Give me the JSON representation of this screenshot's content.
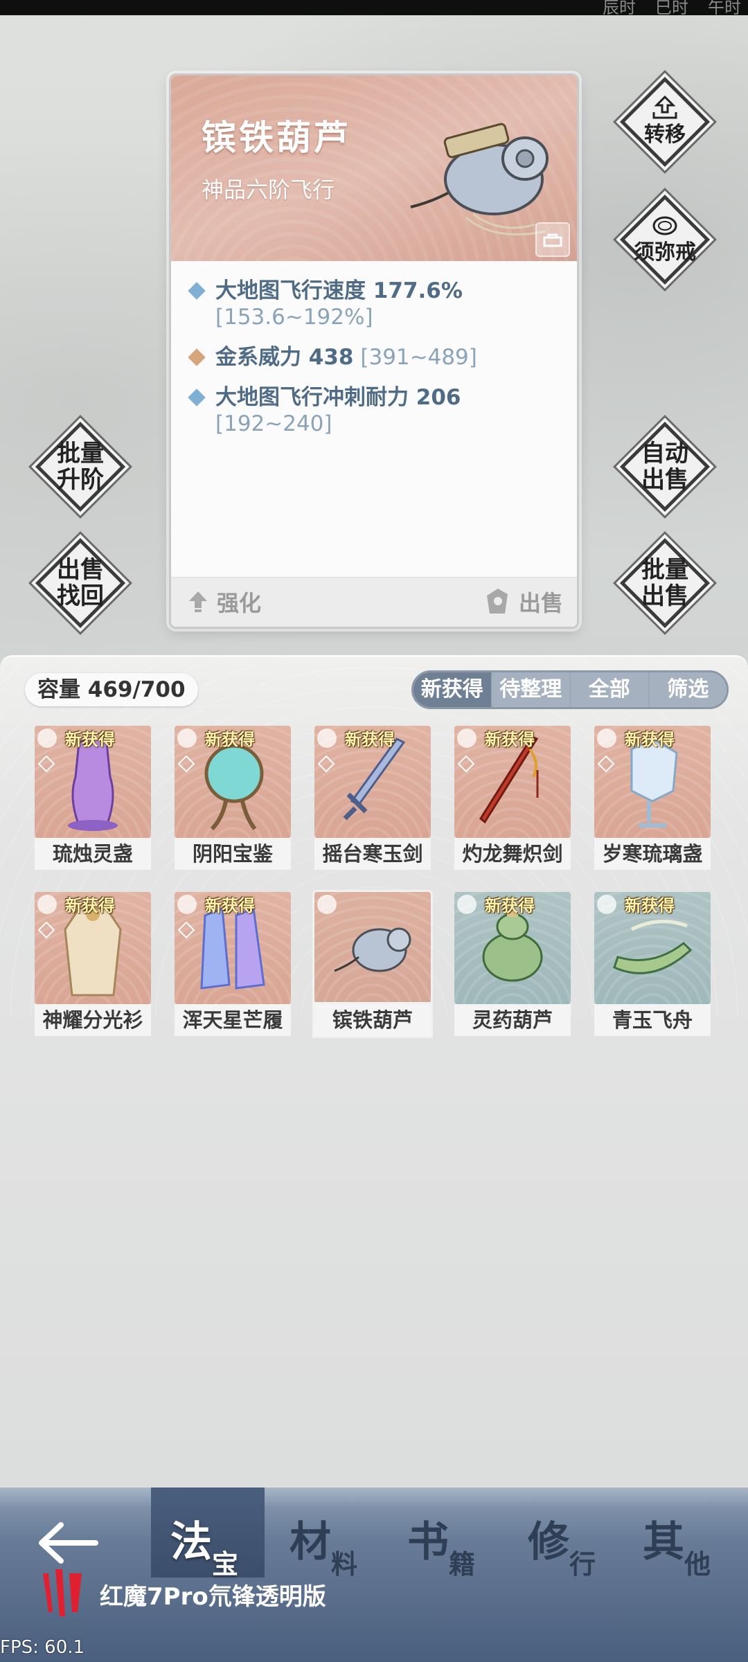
{
  "status_bar": {
    "clock_labels": [
      "辰时",
      "巳时",
      "午时"
    ]
  },
  "item_card": {
    "name": "镔铁葫芦",
    "subtitle": "神品六阶飞行",
    "stats": [
      {
        "name": "大地图飞行速度 177.6%",
        "range": "[153.6~192%]",
        "bullet_color": "#7fb0d3"
      },
      {
        "name": "金系威力 438",
        "range": "[391~489]",
        "bullet_color": "#d6a57c"
      },
      {
        "name": "大地图飞行冲刺耐力 206",
        "range": "[192~240]",
        "bullet_color": "#7fb0d3"
      }
    ],
    "enhance_label": "强化",
    "sell_label": "出售"
  },
  "side_buttons": {
    "transfer": "转移",
    "sumeru_ring": "须弥戒",
    "batch_upgrade": [
      "批量",
      "升阶"
    ],
    "auto_sell": [
      "自动",
      "出售"
    ],
    "sell_recover": [
      "出售",
      "找回"
    ],
    "batch_sell": [
      "批量",
      "出售"
    ]
  },
  "inventory": {
    "capacity_label": "容量 469/700",
    "filters": [
      "新获得",
      "待整理",
      "全部",
      "筛选"
    ],
    "new_tag": "新获得",
    "items": [
      {
        "name": "琉烛灵盏",
        "is_new": true
      },
      {
        "name": "阴阳宝鉴",
        "is_new": true
      },
      {
        "name": "摇台寒玉剑",
        "is_new": true
      },
      {
        "name": "灼龙舞炽剑",
        "is_new": true
      },
      {
        "name": "岁寒琉璃盏",
        "is_new": true
      },
      {
        "name": "神耀分光衫",
        "is_new": true
      },
      {
        "name": "浑天星芒履",
        "is_new": true
      },
      {
        "name": "镔铁葫芦",
        "is_new": false
      },
      {
        "name": "灵药葫芦",
        "is_new": true
      },
      {
        "name": "青玉飞舟",
        "is_new": true
      }
    ]
  },
  "bottom_nav": {
    "tabs": [
      {
        "big": "法",
        "small": "宝"
      },
      {
        "big": "材",
        "small": "料"
      },
      {
        "big": "书",
        "small": "籍"
      },
      {
        "big": "修",
        "small": "行"
      },
      {
        "big": "其",
        "small": "他"
      }
    ],
    "device_label": "红魔7Pro氘锋透明版",
    "fps": "FPS: 60.1"
  }
}
